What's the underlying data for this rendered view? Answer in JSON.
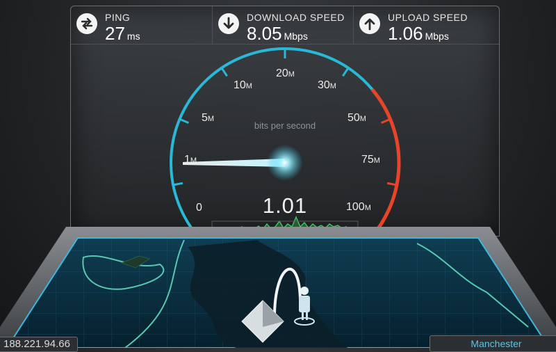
{
  "stats": {
    "ping": {
      "label": "PING",
      "value": "27",
      "unit": "ms",
      "icon": "ping-arrows-icon"
    },
    "download": {
      "label": "DOWNLOAD SPEED",
      "value": "8.05",
      "unit": "Mbps",
      "icon": "download-arrow-icon"
    },
    "upload": {
      "label": "UPLOAD SPEED",
      "value": "1.06",
      "unit": "Mbps",
      "icon": "upload-arrow-icon"
    }
  },
  "gauge": {
    "caption": "bits per second",
    "current_value": "1.01",
    "ticks": [
      {
        "num": "0",
        "suffix": ""
      },
      {
        "num": "1",
        "suffix": "M"
      },
      {
        "num": "5",
        "suffix": "M"
      },
      {
        "num": "10",
        "suffix": "M"
      },
      {
        "num": "20",
        "suffix": "M"
      },
      {
        "num": "30",
        "suffix": "M"
      },
      {
        "num": "50",
        "suffix": "M"
      },
      {
        "num": "75",
        "suffix": "M"
      },
      {
        "num": "100",
        "suffix": "M"
      }
    ],
    "colors": {
      "arc": "#29b8d6",
      "high_arc": "#e8442a",
      "needle": "#dff6ff",
      "graph": "#3ec25a"
    }
  },
  "map": {
    "ip_address": "188.221.94.66",
    "server_city": "Manchester"
  }
}
